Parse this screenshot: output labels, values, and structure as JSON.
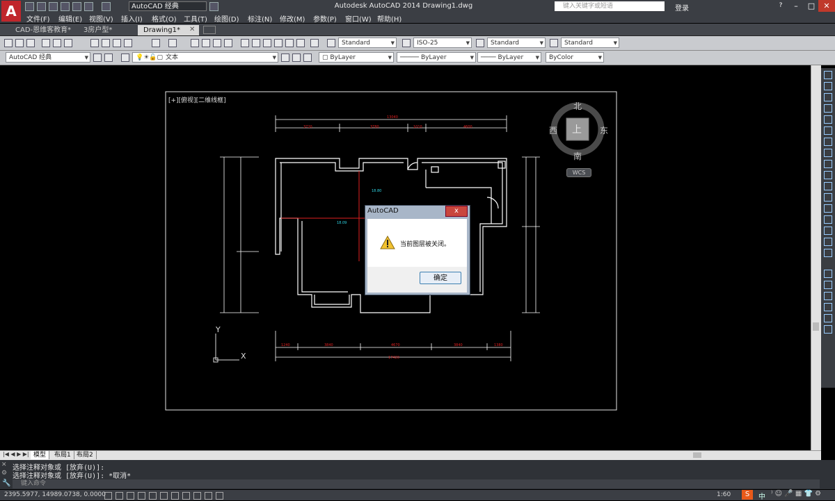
{
  "titlebar": {
    "app_letter": "A",
    "workspace": "AutoCAD 经典",
    "window_title": "Autodesk AutoCAD 2014    Drawing1.dwg",
    "search_placeholder": "键入关键字或短语",
    "login_label": "登录"
  },
  "menu": [
    "文件(F)",
    "编辑(E)",
    "视图(V)",
    "插入(I)",
    "格式(O)",
    "工具(T)",
    "绘图(D)",
    "标注(N)",
    "修改(M)",
    "参数(P)",
    "窗口(W)",
    "帮助(H)"
  ],
  "tabs": [
    "CAD-恩维客教育*",
    "3房户型*",
    "Drawing1*"
  ],
  "toolbar1": {
    "text_style": "Standard",
    "dim_style": "ISO-25",
    "table_style": "Standard",
    "mleader_style": "Standard"
  },
  "toolbar2": {
    "workspace": "AutoCAD 经典",
    "layer": "文本",
    "color": "ByLayer",
    "linetype": "ByLayer",
    "lineweight": "ByLayer",
    "plotstyle": "ByColor"
  },
  "viewport": {
    "label": "[+][俯视][二维线框]",
    "compass": {
      "north": "北",
      "south": "南",
      "east": "东",
      "west": "西",
      "top": "上"
    },
    "wcs_label": "WCS",
    "ucs_x": "X",
    "ucs_y": "Y"
  },
  "plan_dims": {
    "top_total": "13040",
    "top_segments": [
      "3720",
      "3780",
      "1010",
      "4600"
    ],
    "bottom_total": "17420",
    "bottom_segments": [
      "1240",
      "3840",
      "4670",
      "3840",
      "1380"
    ],
    "room_labels": [
      "18.80",
      "18.09"
    ]
  },
  "dialog": {
    "title": "AutoCAD",
    "message": "当前图层被关闭。",
    "ok_label": "确定",
    "close_label": "x"
  },
  "layout_tabs": [
    "模型",
    "布局1",
    "布局2"
  ],
  "command": {
    "line1": "选择注释对象或 [放弃(U)]:",
    "line2": "选择注释对象或 [放弃(U)]: *取消*",
    "input_placeholder": "键入命令"
  },
  "status": {
    "coords": "2395.5977,  14989.0738, 0.0000",
    "scale": "1:60"
  }
}
